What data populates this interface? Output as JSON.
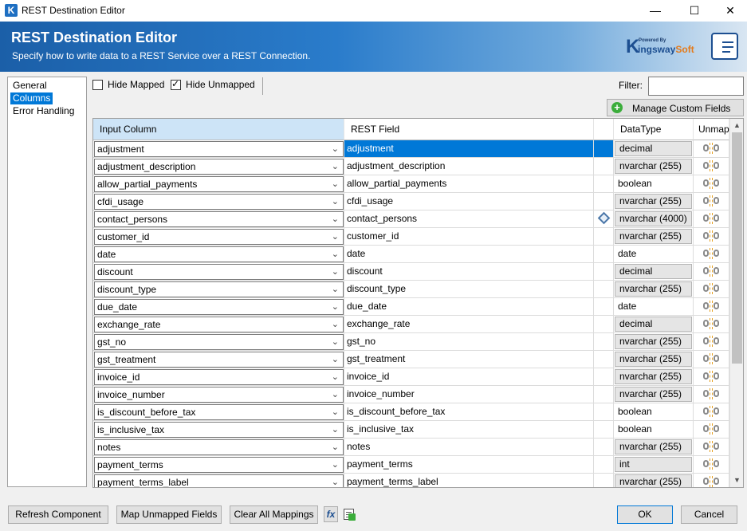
{
  "window": {
    "title": "REST Destination Editor",
    "minimize": "—",
    "maximize": "☐",
    "close": "✕"
  },
  "header": {
    "title": "REST Destination Editor",
    "subtitle": "Specify how to write data to a REST Service over a REST Connection.",
    "logo_powered": "Powered By",
    "logo_k": "K",
    "logo_ingsway": "ingsway",
    "logo_soft": "Soft"
  },
  "nav": {
    "items": [
      {
        "label": "General"
      },
      {
        "label": "Columns"
      },
      {
        "label": "Error Handling"
      }
    ]
  },
  "toolbar": {
    "hide_mapped": "Hide Mapped",
    "hide_mapped_checked": false,
    "hide_unmapped": "Hide Unmapped",
    "hide_unmapped_checked": true,
    "filter_label": "Filter:",
    "filter_value": "",
    "manage_custom_fields": "Manage Custom Fields"
  },
  "grid": {
    "headers": {
      "input": "Input Column",
      "rest": "REST Field",
      "datatype": "DataType",
      "unmap": "Unmap"
    },
    "rows": [
      {
        "input": "adjustment",
        "rest": "adjustment",
        "datatype": "decimal",
        "dt_boxed": true,
        "selected": true,
        "icon": ""
      },
      {
        "input": "adjustment_description",
        "rest": "adjustment_description",
        "datatype": "nvarchar (255)",
        "dt_boxed": true,
        "icon": ""
      },
      {
        "input": "allow_partial_payments",
        "rest": "allow_partial_payments",
        "datatype": "boolean",
        "dt_boxed": false,
        "icon": ""
      },
      {
        "input": "cfdi_usage",
        "rest": "cfdi_usage",
        "datatype": "nvarchar (255)",
        "dt_boxed": true,
        "icon": ""
      },
      {
        "input": "contact_persons",
        "rest": "contact_persons",
        "datatype": "nvarchar (4000)",
        "dt_boxed": true,
        "icon": "diamond-icon"
      },
      {
        "input": "customer_id",
        "rest": "customer_id",
        "datatype": "nvarchar (255)",
        "dt_boxed": true,
        "icon": ""
      },
      {
        "input": "date",
        "rest": "date",
        "datatype": "date",
        "dt_boxed": false,
        "icon": ""
      },
      {
        "input": "discount",
        "rest": "discount",
        "datatype": "decimal",
        "dt_boxed": true,
        "icon": ""
      },
      {
        "input": "discount_type",
        "rest": "discount_type",
        "datatype": "nvarchar (255)",
        "dt_boxed": true,
        "icon": ""
      },
      {
        "input": "due_date",
        "rest": "due_date",
        "datatype": "date",
        "dt_boxed": false,
        "icon": ""
      },
      {
        "input": "exchange_rate",
        "rest": "exchange_rate",
        "datatype": "decimal",
        "dt_boxed": true,
        "icon": ""
      },
      {
        "input": "gst_no",
        "rest": "gst_no",
        "datatype": "nvarchar (255)",
        "dt_boxed": true,
        "icon": ""
      },
      {
        "input": "gst_treatment",
        "rest": "gst_treatment",
        "datatype": "nvarchar (255)",
        "dt_boxed": true,
        "icon": ""
      },
      {
        "input": "invoice_id",
        "rest": "invoice_id",
        "datatype": "nvarchar (255)",
        "dt_boxed": true,
        "icon": ""
      },
      {
        "input": "invoice_number",
        "rest": "invoice_number",
        "datatype": "nvarchar (255)",
        "dt_boxed": true,
        "icon": ""
      },
      {
        "input": "is_discount_before_tax",
        "rest": "is_discount_before_tax",
        "datatype": "boolean",
        "dt_boxed": false,
        "icon": ""
      },
      {
        "input": "is_inclusive_tax",
        "rest": "is_inclusive_tax",
        "datatype": "boolean",
        "dt_boxed": false,
        "icon": ""
      },
      {
        "input": "notes",
        "rest": "notes",
        "datatype": "nvarchar (255)",
        "dt_boxed": true,
        "icon": ""
      },
      {
        "input": "payment_terms",
        "rest": "payment_terms",
        "datatype": "int",
        "dt_boxed": true,
        "icon": ""
      },
      {
        "input": "payment_terms_label",
        "rest": "payment_terms_label",
        "datatype": "nvarchar (255)",
        "dt_boxed": true,
        "icon": ""
      }
    ]
  },
  "buttons": {
    "refresh": "Refresh Component",
    "map_unmapped": "Map Unmapped Fields",
    "clear_all": "Clear All Mappings",
    "fx": "fx",
    "ok": "OK",
    "cancel": "Cancel"
  },
  "colors": {
    "selection": "#0078d7",
    "header_gradient_start": "#1b5fa8",
    "accent_orange": "#e47a1a"
  }
}
